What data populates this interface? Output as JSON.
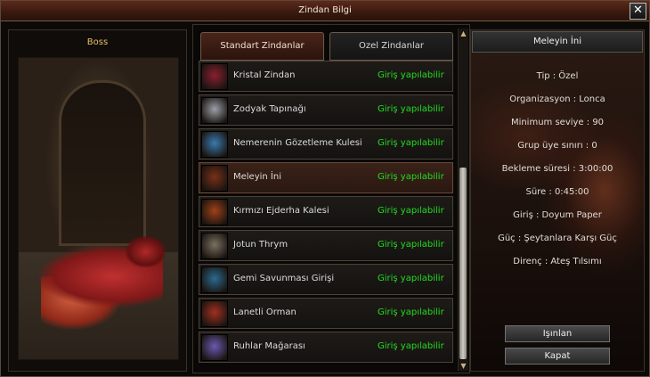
{
  "window": {
    "title": "Zindan Bilgi",
    "close_label": "✕"
  },
  "boss": {
    "label": "Boss"
  },
  "tabs": [
    {
      "label": "Standart Zindanlar"
    },
    {
      "label": "Ozel Zindanlar"
    }
  ],
  "dungeons": [
    {
      "name": "Kristal Zindan",
      "status": "Giriş yapılabilir",
      "icon": "crystal-creature-icon",
      "color": "#8a2030"
    },
    {
      "name": "Zodyak Tapınağı",
      "status": "Giriş yapılabilir",
      "icon": "zodiac-creature-icon",
      "color": "#9aa0a8"
    },
    {
      "name": "Nemerenin Gözetleme Kulesi",
      "status": "Giriş yapılabilir",
      "icon": "ice-creature-icon",
      "color": "#3a7ab0"
    },
    {
      "name": "Meleyin İni",
      "status": "Giriş yapılabilir",
      "icon": "dragon-icon",
      "color": "#7a3018"
    },
    {
      "name": "Kırmızı Ejderha Kalesi",
      "status": "Giriş yapılabilir",
      "icon": "red-dragon-icon",
      "color": "#a04018"
    },
    {
      "name": "Jotun Thrym",
      "status": "Giriş yapılabilir",
      "icon": "giant-icon",
      "color": "#7a7060"
    },
    {
      "name": "Gemi Savunması Girişi",
      "status": "Giriş yapılabilir",
      "icon": "sea-creature-icon",
      "color": "#2a6a90"
    },
    {
      "name": "Lanetli Orman",
      "status": "Giriş yapılabilir",
      "icon": "forest-creature-icon",
      "color": "#a03020"
    },
    {
      "name": "Ruhlar Mağarası",
      "status": "Giriş yapılabilir",
      "icon": "spirit-icon",
      "color": "#6a5ab0"
    }
  ],
  "selected_index": 3,
  "info": {
    "title": "Meleyin İni",
    "lines": [
      "Tip : Özel",
      "Organizasyon : Lonca",
      "Minimum seviye : 90",
      "Grup üye sınırı : 0",
      "Bekleme süresi : 3:00:00",
      "Süre : 0:45:00",
      "Giriş : Doyum Paper",
      "Güç : Şeytanlara Karşı Güç",
      "Direnç : Ateş Tılsımı"
    ],
    "teleport_label": "Işınlan",
    "close_label": "Kapat"
  },
  "colors": {
    "status_green": "#22dd22",
    "boss_label": "#e8c070",
    "title_bar": "#5e2a1a"
  }
}
